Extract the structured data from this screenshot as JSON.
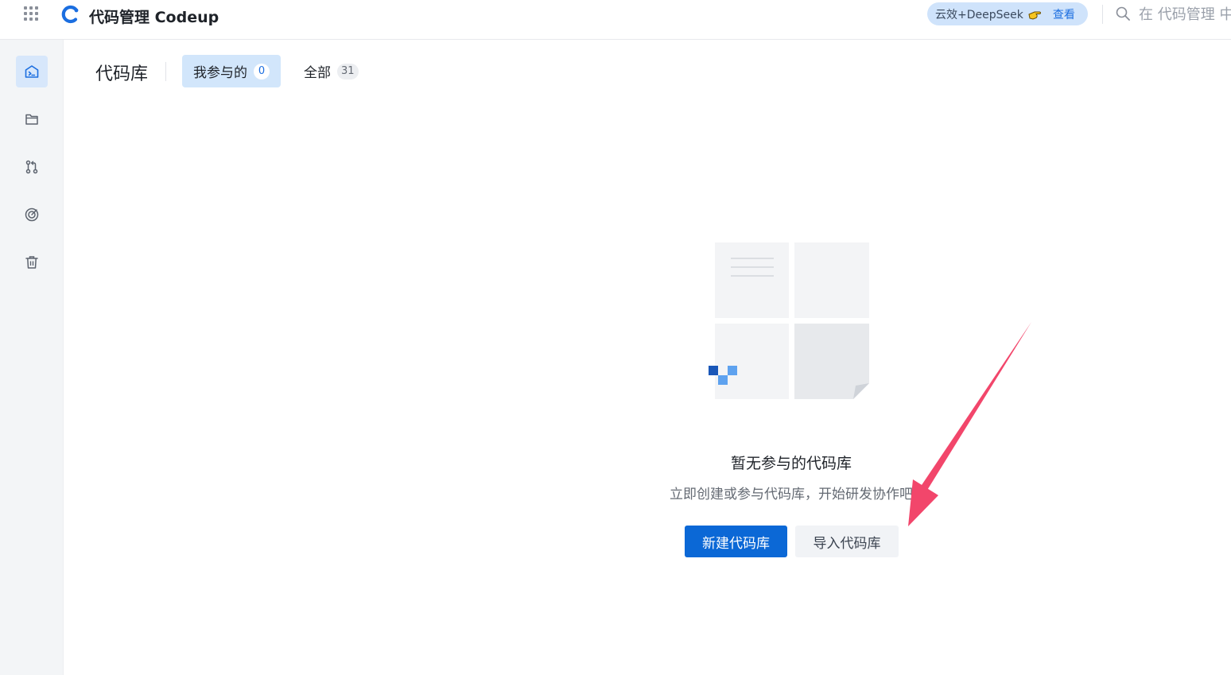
{
  "header": {
    "app_title": "代码管理 Codeup",
    "promo_text": "云效+DeepSeek",
    "promo_link": "查看",
    "search_placeholder": "在 代码管理 中"
  },
  "sidebar": {
    "items": [
      {
        "icon": "repo-home-icon",
        "active": true
      },
      {
        "icon": "folder-icon",
        "active": false
      },
      {
        "icon": "merge-request-icon",
        "active": false
      },
      {
        "icon": "target-icon",
        "active": false
      },
      {
        "icon": "trash-icon",
        "active": false
      }
    ]
  },
  "main": {
    "section_title": "代码库",
    "tabs": [
      {
        "label": "我参与的",
        "count": "0",
        "active": true
      },
      {
        "label": "全部",
        "count": "31",
        "active": false
      }
    ],
    "empty_state": {
      "title": "暂无参与的代码库",
      "description": "立即创建或参与代码库，开始研发协作吧",
      "primary_button": "新建代码库",
      "secondary_button": "导入代码库"
    }
  },
  "colors": {
    "accent": "#0b68d6",
    "active_tab_bg": "#d2e6fb",
    "sidebar_bg": "#f3f5f7",
    "promo_bg": "#cfe3fb",
    "annotation_arrow": "#f2466b"
  }
}
